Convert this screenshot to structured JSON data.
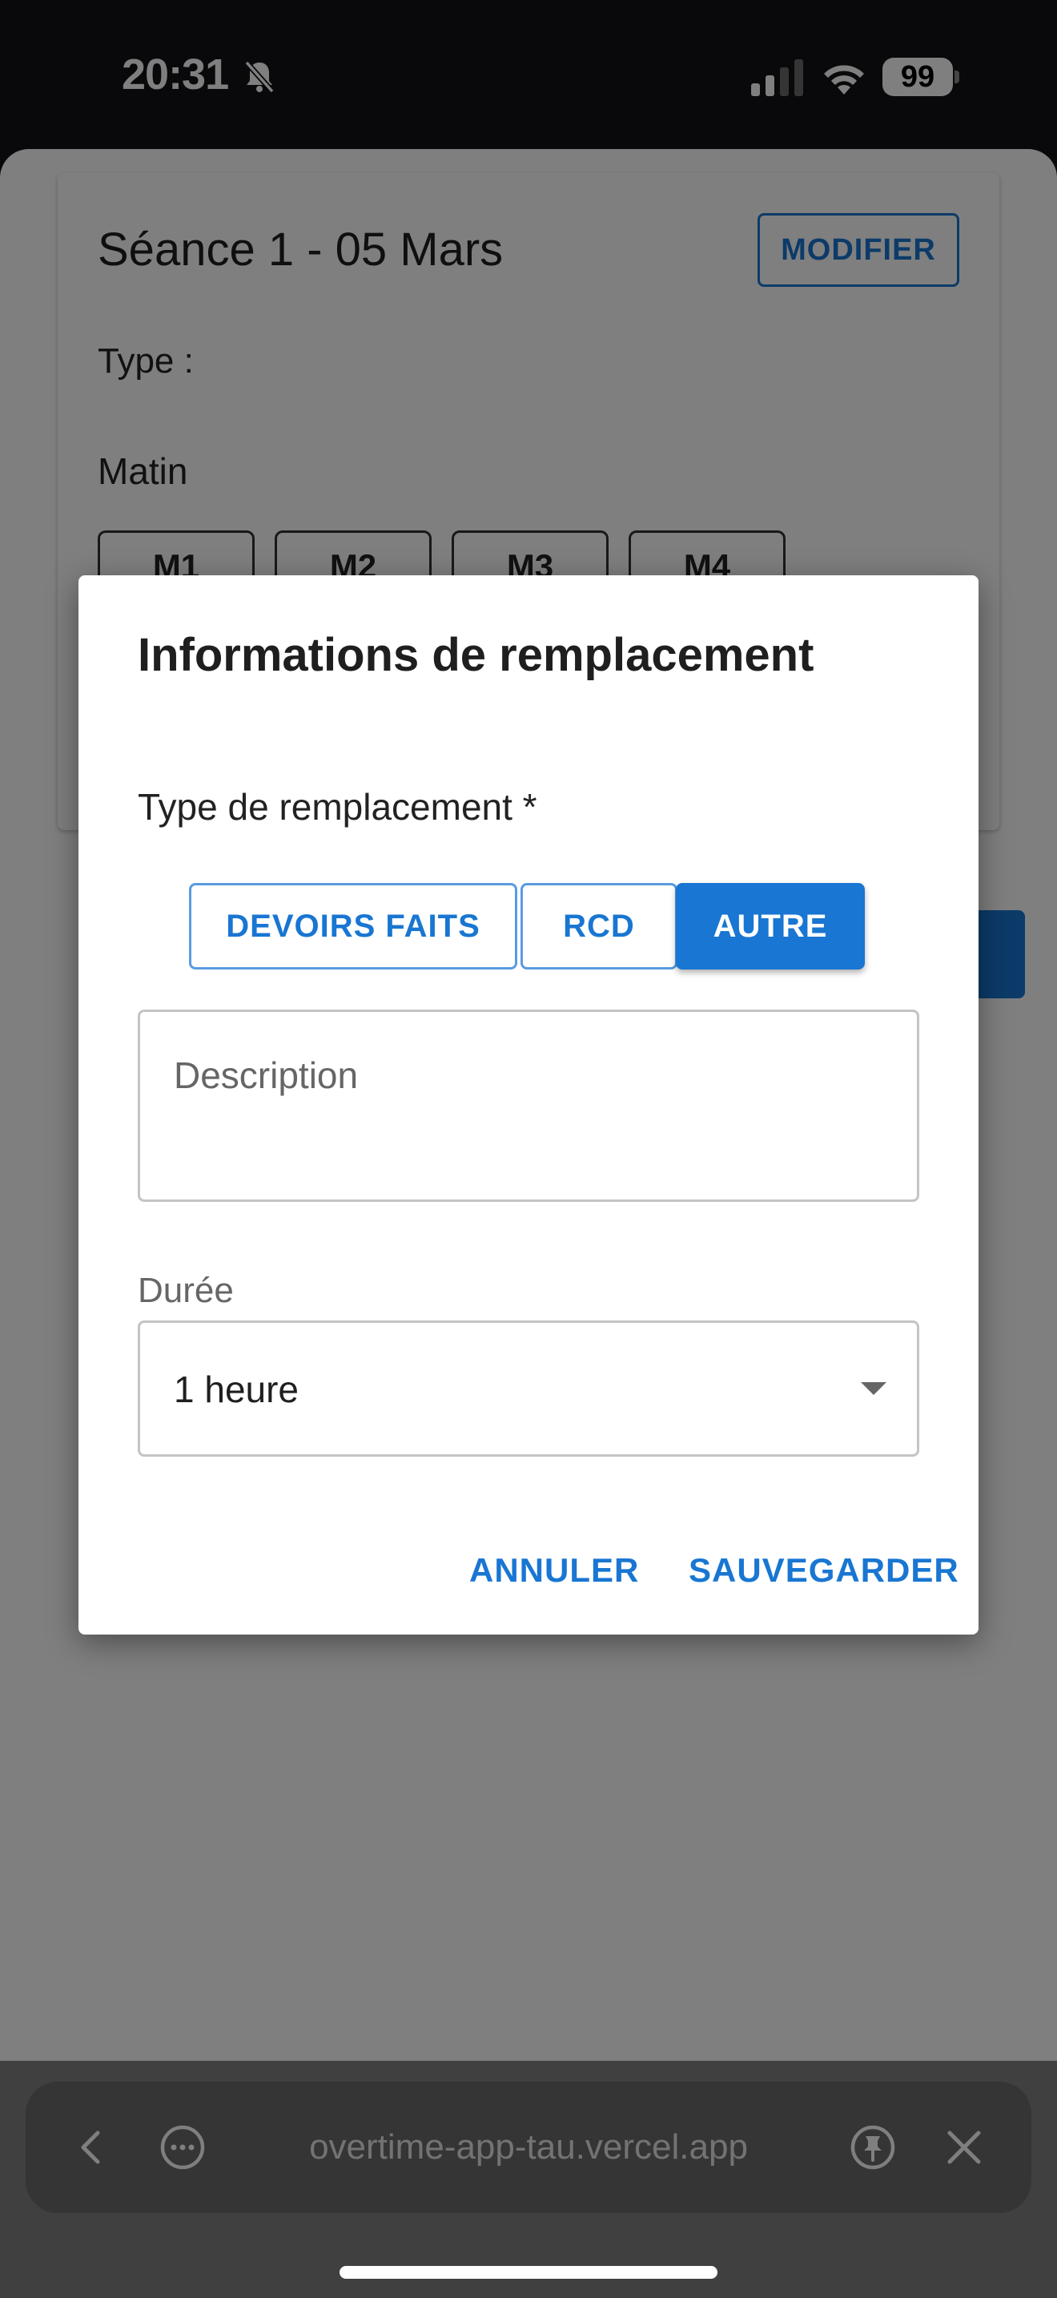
{
  "status_bar": {
    "time": "20:31",
    "battery": "99",
    "icons": [
      "bell-slash-icon",
      "signal-icon",
      "wifi-icon",
      "battery-icon"
    ]
  },
  "card": {
    "title": "Séance 1 - 05 Mars",
    "modify_label": "MODIFIER",
    "type_label": "Type :",
    "matin_label": "Matin",
    "slots": [
      "M1",
      "M2",
      "M3",
      "M4"
    ]
  },
  "dialog": {
    "title": "Informations de remplacement",
    "type_label": "Type de remplacement *",
    "options": [
      "DEVOIRS FAITS",
      "RCD",
      "AUTRE"
    ],
    "selected_option": "AUTRE",
    "description_placeholder": "Description",
    "duree_label": "Durée",
    "duree_value": "1 heure",
    "cancel_label": "ANNULER",
    "save_label": "SAUVEGARDER"
  },
  "browser": {
    "url": "overtime-app-tau.vercel.app",
    "icons": [
      "back-icon",
      "more-icon",
      "pin-icon",
      "close-icon"
    ]
  },
  "colors": {
    "accent": "#1976d2",
    "scrim": "#000000"
  }
}
